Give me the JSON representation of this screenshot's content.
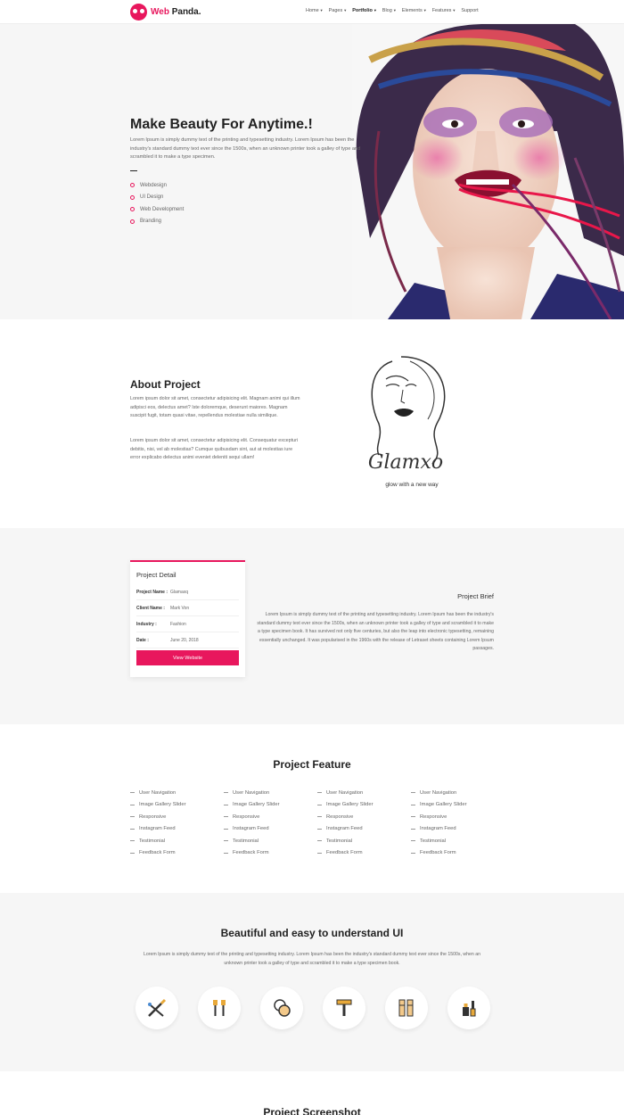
{
  "brand": {
    "name_part1": "Web",
    "name_part2": "Panda."
  },
  "nav": [
    {
      "label": "Home"
    },
    {
      "label": "Pages"
    },
    {
      "label": "Portfolio"
    },
    {
      "label": "Blog"
    },
    {
      "label": "Elements"
    },
    {
      "label": "Features"
    },
    {
      "label": "Support"
    }
  ],
  "hero": {
    "title": "Make Beauty For Anytime.!",
    "desc": "Lorem Ipsum is simply dummy text of the printing and typesetting industry. Lorem Ipsum has been the industry's standard dummy text ever since the 1500s, when an unknown printer took a galley of type and scrambled it to make a type specimen.",
    "list": [
      "Webdesign",
      "UI Design",
      "Web Development",
      "Branding"
    ]
  },
  "about": {
    "title": "About Project",
    "p1": "Lorem ipsum dolor sit amet, consectetur adipisicing elit. Magnam animi qui illum adipisci eos, delectus amet? Iste doloremque, deserunt maiores. Magnam suscipit fugit, totam quasi vitae, repellendus molestiae nulla similique.",
    "p2": "Lorem ipsum dolor sit amet, consectetur adipisicing elit. Consequatur excepturi debitis, nisi, vel ab molestias? Cumque quibusdam sint, aut at molestias iure error explicabo delectus animi eveniet deleniti sequi ullam!",
    "logo_name": "Glamxo",
    "logo_tagline": "glow with a new way"
  },
  "detail": {
    "title": "Project Detail",
    "rows": [
      {
        "k": "Project Name :",
        "v": "Glamaxq"
      },
      {
        "k": "Client Name :",
        "v": "Mark Von"
      },
      {
        "k": "Industry :",
        "v": "Fashion"
      },
      {
        "k": "Date :",
        "v": "June 20, 2018"
      }
    ],
    "button": "View Website",
    "brief_title": "Project Brief",
    "brief_text": "Lorem Ipsum is simply dummy text of the printing and typesetting industry. Lorem Ipsum has been the industry's standard dummy text ever since the 1500s, when an unknown printer took a galley of type and scrambled it to make a type specimen book. It has survived not only five centuries, but also the leap into electronic typesetting, remaining essentially unchanged. It was popularised in the 1960s with the release of Letraset sheets containing Lorem Ipsum passages."
  },
  "features": {
    "title": "Project Feature",
    "columns": [
      [
        "User Navigation",
        "Image Gallery Slider",
        "Responsive",
        "Instagram Feed",
        "Testimonial",
        "Feedback Form"
      ],
      [
        "User Navigation",
        "Image Gallery Slider",
        "Responsive",
        "Instagram Feed",
        "Testimonial",
        "Feedback Form"
      ],
      [
        "User Navigation",
        "Image Gallery Slider",
        "Responsive",
        "Instagram Feed",
        "Testimonial",
        "Feedback Form"
      ],
      [
        "User Navigation",
        "Image Gallery Slider",
        "Responsive",
        "Instagram Feed",
        "Testimonial",
        "Feedback Form"
      ]
    ]
  },
  "ui_section": {
    "title": "Beautiful and easy to understand UI",
    "desc": "Lorem Ipsum is simply dummy text of the printing and typesetting industry. Lorem Ipsum has been the industry's standard dummy text ever since the 1500s, when an unknown printer took a galley of type and scrambled it to make a type specimen book.",
    "icons": [
      "brushes-icon",
      "makeup-brushes-icon",
      "compact-powder-icon",
      "razor-icon",
      "cosmetic-tubes-icon",
      "lipstick-bottle-icon"
    ]
  },
  "screenshot": {
    "title": "Project Screenshot"
  },
  "colors": {
    "accent": "#e8175d",
    "dark": "#222222",
    "bg_gray": "#f6f6f6"
  }
}
